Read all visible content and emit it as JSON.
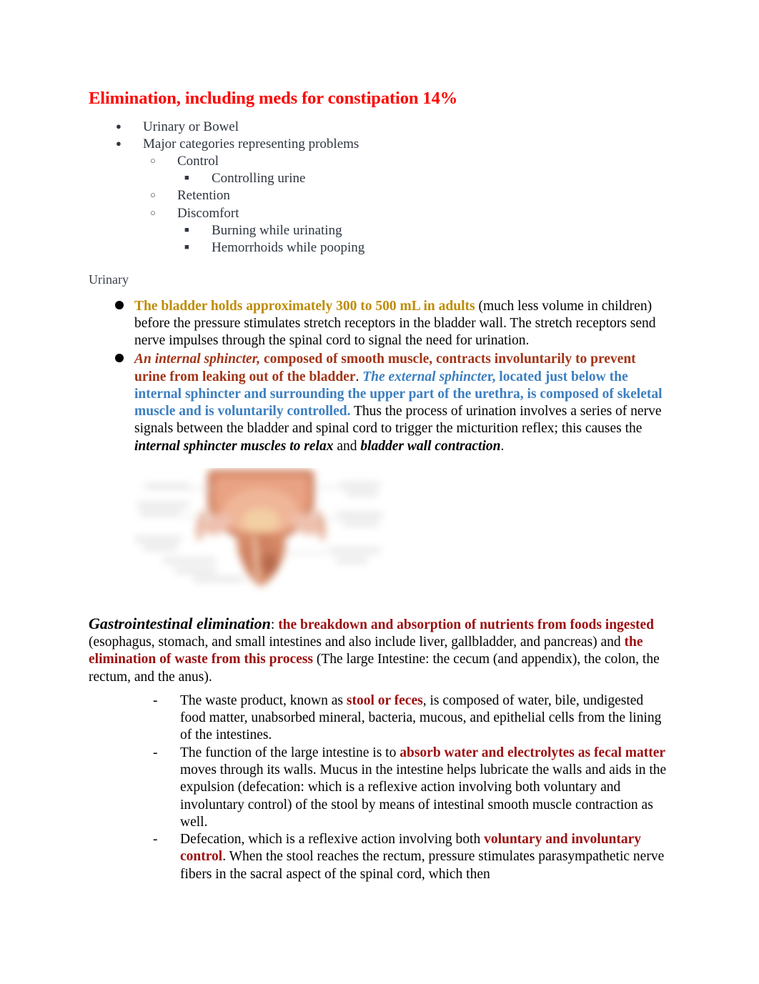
{
  "document": {
    "title": "Elimination, including meds for constipation 14%",
    "colors": {
      "title_red": "#FF0000",
      "gold": "#BE8C08",
      "brick_red": "#A33417",
      "blue": "#3C7FC0",
      "dark_red": "#9C0F0F",
      "outline_gray": "#2F3640"
    }
  },
  "outline": [
    {
      "level": 1,
      "marker": "disc",
      "label": "Urinary or Bowel"
    },
    {
      "level": 1,
      "marker": "disc",
      "label": "Major categories representing problems"
    },
    {
      "level": 2,
      "marker": "circle",
      "label": "Control"
    },
    {
      "level": 3,
      "marker": "square",
      "label": "Controlling urine"
    },
    {
      "level": 2,
      "marker": "circle",
      "label": "Retention"
    },
    {
      "level": 2,
      "marker": "circle",
      "label": "Discomfort"
    },
    {
      "level": 3,
      "marker": "square",
      "label": "Burning while urinating"
    },
    {
      "level": 3,
      "marker": "square",
      "label": "Hemorrhoids while pooping"
    }
  ],
  "urinary": {
    "section_label": "Urinary",
    "bullet1": {
      "gold_text": "The bladder holds approximately 300 to 500 mL in adults",
      "rest": " (much less volume in children) before the pressure stimulates stretch receptors in the bladder wall. The stretch receptors send nerve impulses through the spinal cord to signal the need for urination."
    },
    "bullet2": {
      "brick_italic": "An internal sphincter,",
      "brick_bold": " composed of smooth muscle, contracts involuntarily to prevent urine from leaking out of the bladder",
      "period1": ". ",
      "blue_italic": "The external sphincte",
      "blue_bold": "r, located just below the internal sphincter and surrounding the upper part of the urethra, is composed of skeletal muscle and is voluntarily controlled.",
      "plain1": " Thus the process of urination involves a series of nerve signals between the bladder and spinal cord to trigger the micturition reflex; this causes the ",
      "bold_italic1": "internal sphincter muscles to relax",
      "plain2": " and ",
      "bold_italic2": "bladder wall contraction",
      "period2": "."
    }
  },
  "figure": {
    "name": "bladder-prostate-anatomy-diagram",
    "caption": ""
  },
  "gastrointestinal": {
    "heading": "Gastrointestinal elimination",
    "colon": ":",
    "red1": " the breakdown and absorption of nutrients from foods ingested",
    "plain1": " (esophagus, stomach, and small intestines and also include liver, gallbladder, and pancreas) and ",
    "red2": "the elimination of waste from this process",
    "plain2": " (The large Intestine: the cecum (and appendix), the colon, the rectum, and the anus).",
    "items": [
      {
        "plain1": "The waste product, known as ",
        "red": "stool or feces",
        "plain2": ", is composed of water, bile, undigested food matter, unabsorbed mineral, bacteria, mucous, and epithelial cells from the lining of the intestines."
      },
      {
        "plain1": "The function of the large intestine is to ",
        "red": "absorb water and electrolytes as fecal matter",
        "plain2": " moves through its walls. Mucus in the intestine helps lubricate the walls and aids in the expulsion (defecation: which is a reflexive action involving both voluntary and involuntary control) of the stool by means of intestinal smooth muscle contraction as well."
      },
      {
        "plain1": "Defecation, which is a reflexive action involving both ",
        "red": "voluntary and involuntary control",
        "plain2": ". When the stool reaches the rectum, pressure stimulates parasympathetic nerve fibers in the sacral aspect of the spinal cord, which then"
      }
    ],
    "dash_marker": "-"
  }
}
